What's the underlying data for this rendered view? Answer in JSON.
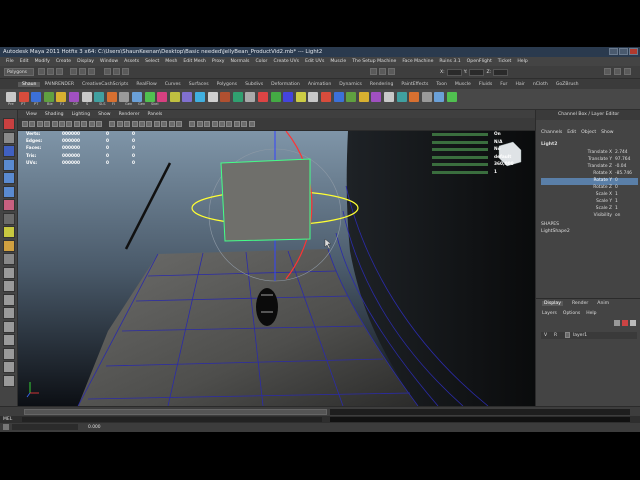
{
  "window": {
    "title": "Autodesk Maya 2011 Hotfix 3 x64: C:\\Users\\ShaunKeenan\\Desktop\\Basic needed\\JellyBean_ProductVid2.mb* --- Light2"
  },
  "menubar": [
    "File",
    "Edit",
    "Modify",
    "Create",
    "Display",
    "Window",
    "Assets",
    "Select",
    "Mesh",
    "Edit Mesh",
    "Proxy",
    "Normals",
    "Color",
    "Create UVs",
    "Edit UVs",
    "Muscle",
    "The Setup Machine",
    "Face Machine",
    "Ruins 3.1",
    "OpenFlight",
    "Ticket",
    "Help"
  ],
  "statusline": {
    "mode": "Polygons",
    "x_label": "X:",
    "y_label": "Y:",
    "z_label": "Z:"
  },
  "shelf": {
    "tabs": [
      "Shaun",
      "PAINRENDER",
      "CreativeCashScripts",
      "RealFlow",
      "Curves",
      "Surfaces",
      "Polygons",
      "Subdivs",
      "Deformation",
      "Animation",
      "Dynamics",
      "Rendering",
      "PaintEffects",
      "Toon",
      "Muscle",
      "Fluids",
      "Fur",
      "Hair",
      "nCloth",
      "GoZBrush"
    ],
    "active_tab": "Shaun",
    "buttons": [
      "Pre",
      "PT",
      "PT",
      "Ble",
      "F1",
      "CP",
      "S",
      "SLS",
      "FI",
      "Gen",
      "Gen",
      "Skel"
    ]
  },
  "viewport": {
    "menu": [
      "View",
      "Shading",
      "Lighting",
      "Show",
      "Renderer",
      "Panels"
    ],
    "hud_left": [
      {
        "label": "Verts:",
        "v1": "000000",
        "v2": "0",
        "v3": "0"
      },
      {
        "label": "Edges:",
        "v1": "000000",
        "v2": "0",
        "v3": "0"
      },
      {
        "label": "Faces:",
        "v1": "000000",
        "v2": "0",
        "v3": "0"
      },
      {
        "label": "Tris:",
        "v1": "000000",
        "v2": "0",
        "v3": "0"
      },
      {
        "label": "UVs:",
        "v1": "000000",
        "v2": "0",
        "v3": "0"
      }
    ],
    "hud_right_values": [
      "On",
      "N/A",
      "No",
      "default",
      "360,000",
      "1"
    ]
  },
  "channel_box": {
    "title": "Channel Box / Layer Editor",
    "menu": [
      "Channels",
      "Edit",
      "Object",
      "Show"
    ],
    "object": "Light2",
    "attributes": [
      {
        "name": "Translate X",
        "value": "2.744",
        "selected": false
      },
      {
        "name": "Translate Y",
        "value": "97.764",
        "selected": false
      },
      {
        "name": "Translate Z",
        "value": "-0.04",
        "selected": false
      },
      {
        "name": "Rotate X",
        "value": "-85.746",
        "selected": false
      },
      {
        "name": "Rotate Y",
        "value": "0",
        "selected": true
      },
      {
        "name": "Rotate Z",
        "value": "0",
        "selected": false
      },
      {
        "name": "Scale X",
        "value": "1",
        "selected": false
      },
      {
        "name": "Scale Y",
        "value": "1",
        "selected": false
      },
      {
        "name": "Scale Z",
        "value": "1",
        "selected": false
      },
      {
        "name": "Visibility",
        "value": "on",
        "selected": false
      }
    ],
    "shapes_header": "SHAPES",
    "shape_name": "LightShape2"
  },
  "layer_editor": {
    "tabs": [
      "Display",
      "Render",
      "Anim"
    ],
    "active_tab": "Display",
    "menu": [
      "Layers",
      "Options",
      "Help"
    ],
    "row": {
      "v": "V",
      "r": "R",
      "name": "layer1"
    }
  },
  "bottom": {
    "mel_label": "MEL",
    "coord": "0.000"
  }
}
